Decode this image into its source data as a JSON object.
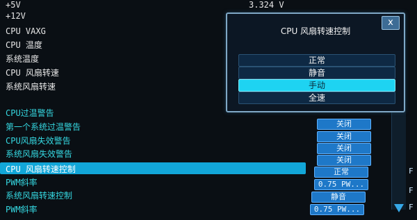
{
  "voltages": {
    "v5_label": "+5V",
    "v12_label": "+12V",
    "cpu_vaxg_label": "CPU VAXG",
    "top_value": "3.324 V"
  },
  "monitor_labels": {
    "cpu_temp": "CPU 温度",
    "system_temp": "系统温度",
    "cpu_fan_speed": "CPU 风扇转速",
    "system_fan_speed": "系统风扇转速"
  },
  "settings": [
    {
      "label": "CPU过温警告",
      "value": "关闭"
    },
    {
      "label": "第一个系统过温警告",
      "value": "关闭"
    },
    {
      "label": "CPU风扇失效警告",
      "value": "关闭"
    },
    {
      "label": "系统风扇失效警告",
      "value": "关闭"
    },
    {
      "label": "CPU 风扇转速控制",
      "value": "正常"
    },
    {
      "label": "PWM斜率",
      "value": "0.75 PW..."
    },
    {
      "label": "系统风扇转速控制",
      "value": "静音"
    },
    {
      "label": "PWM斜率",
      "value": "0.75 PW..."
    }
  ],
  "dialog": {
    "title": "CPU 风扇转速控制",
    "close_label": "x",
    "options": [
      "正常",
      "静音",
      "手动",
      "全速"
    ],
    "selected": "手动"
  },
  "right_edge": [
    "F",
    "F",
    "F"
  ],
  "colors": {
    "background": "#0a0f14",
    "highlight": "#12a6d8",
    "cyan_text": "#35d7e0",
    "button_blue": "#1e78c8",
    "selected_option": "#1ed3f2"
  }
}
